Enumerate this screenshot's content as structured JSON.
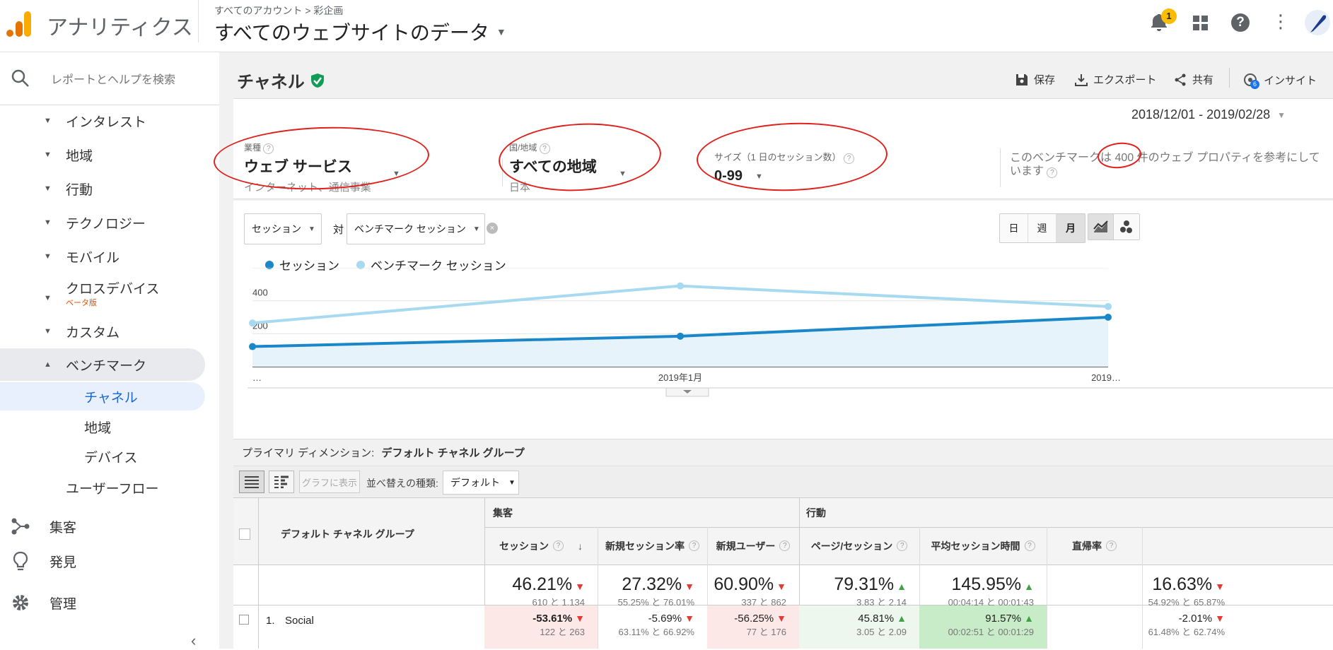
{
  "header": {
    "app_name": "アナリティクス",
    "breadcrumb": "すべてのアカウント > 彩企画",
    "property": "すべてのウェブサイトのデータ",
    "notification_count": "1"
  },
  "sidebar": {
    "search_placeholder": "レポートとヘルプを検索",
    "items": [
      {
        "label": "インタレスト"
      },
      {
        "label": "地域"
      },
      {
        "label": "行動"
      },
      {
        "label": "テクノロジー"
      },
      {
        "label": "モバイル"
      },
      {
        "label": "クロスデバイス",
        "badge": "ベータ版"
      },
      {
        "label": "カスタム"
      },
      {
        "label": "ベンチマーク"
      }
    ],
    "sub_items": [
      {
        "label": "チャネル"
      },
      {
        "label": "地域"
      },
      {
        "label": "デバイス"
      }
    ],
    "user_flow": "ユーザーフロー",
    "bottom": [
      {
        "label": "集客"
      },
      {
        "label": "発見"
      },
      {
        "label": "管理"
      }
    ]
  },
  "report": {
    "title": "チャネル",
    "actions": {
      "save": "保存",
      "export": "エクスポート",
      "share": "共有",
      "insight": "インサイト",
      "insight_badge": "6"
    },
    "date_range": "2018/12/01 - 2019/02/28",
    "filters": {
      "industry_label": "業種",
      "industry_value": "ウェブ サービス",
      "industry_sub": "インターネット、通信事業",
      "region_label": "国/地域",
      "region_value": "すべての地域",
      "region_sub": "日本",
      "size_label": "サイズ（1 日のセッション数）",
      "size_value": "0-99",
      "note": "このベンチマークは 400 件のウェブ プロパティを参考にしています"
    }
  },
  "chart_controls": {
    "metric1": "セッション",
    "vs": "対",
    "metric2": "ベンチマーク セッション",
    "day": "日",
    "week": "週",
    "month": "月"
  },
  "chart_data": {
    "type": "line",
    "x": [
      "…",
      "2019年1月",
      "2019…"
    ],
    "series": [
      {
        "name": "セッション",
        "values": [
          122,
          185,
          300
        ],
        "color": "#1a87c9"
      },
      {
        "name": "ベンチマーク セッション",
        "values": [
          265,
          490,
          365
        ],
        "color": "#a7daf0"
      }
    ],
    "yticks": [
      "600",
      "400",
      "200"
    ],
    "ylim": [
      0,
      600
    ]
  },
  "table": {
    "primary_dimension_label": "プライマリ ディメンション:",
    "primary_dimension_value": "デフォルト チャネル グループ",
    "graph_button": "グラフに表示",
    "sort_label": "並べ替えの種類:",
    "sort_value": "デフォルト",
    "group_acquisition": "集客",
    "group_behavior": "行動",
    "dim_header": "デフォルト チャネル グループ",
    "columns": [
      "セッション",
      "新規セッション率",
      "新規ユーザー",
      "ページ/セッション",
      "平均セッション時間",
      "直帰率"
    ],
    "totals": [
      {
        "value": "46.21%",
        "sub": "610 と 1,134",
        "dir": "down"
      },
      {
        "value": "27.32%",
        "sub": "55.25% と 76.01%",
        "dir": "down"
      },
      {
        "value": "60.90%",
        "sub": "337 と 862",
        "dir": "down"
      },
      {
        "value": "79.31%",
        "sub": "3.83 と 2.14",
        "dir": "up"
      },
      {
        "value": "145.95%",
        "sub": "00:04:14 と 00:01:43",
        "dir": "up"
      },
      {
        "value": "16.63%",
        "sub": "54.92% と 65.87%",
        "dir": "down"
      }
    ],
    "rows": [
      {
        "index": "1.",
        "name": "Social",
        "cells": [
          {
            "value": "-53.61%",
            "sub": "122 と 263",
            "dir": "down"
          },
          {
            "value": "-5.69%",
            "sub": "63.11% と 66.92%",
            "dir": "down"
          },
          {
            "value": "-56.25%",
            "sub": "77 と 176",
            "dir": "down"
          },
          {
            "value": "45.81%",
            "sub": "3.05 と 2.09",
            "dir": "up"
          },
          {
            "value": "91.57%",
            "sub": "00:02:51 と 00:01:29",
            "dir": "up"
          },
          {
            "value": "-2.01%",
            "sub": "61.48% と 62.74%",
            "dir": "down"
          }
        ]
      }
    ]
  }
}
